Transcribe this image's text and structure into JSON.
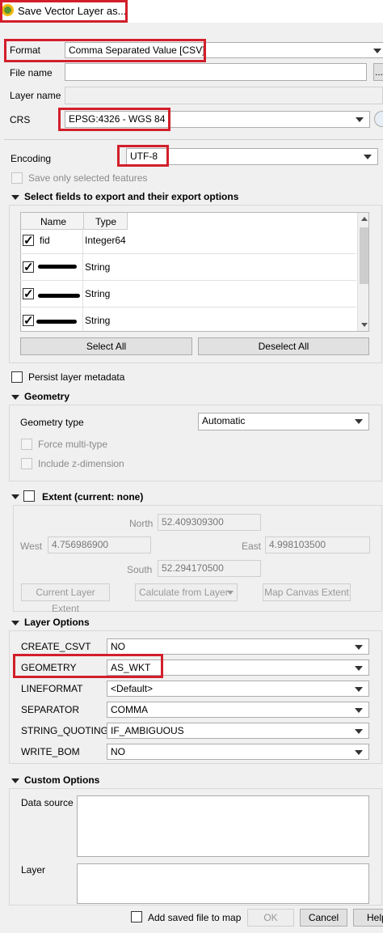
{
  "window": {
    "title": "Save Vector Layer as..."
  },
  "format": {
    "label": "Format",
    "value": "Comma Separated Value [CSV]"
  },
  "file_name": {
    "label": "File name",
    "value": "",
    "browse_label": "..."
  },
  "layer_name": {
    "label": "Layer name",
    "value": ""
  },
  "crs": {
    "label": "CRS",
    "value": "EPSG:4326 - WGS 84"
  },
  "encoding": {
    "label": "Encoding",
    "value": "UTF-8"
  },
  "save_only_selected": {
    "label": "Save only selected features",
    "checked": false,
    "enabled": false
  },
  "fields_section": {
    "title": "Select fields to export and their export options",
    "columns": [
      "Name",
      "Type"
    ],
    "rows": [
      {
        "name": "fid",
        "type": "Integer64",
        "checked": true
      },
      {
        "name": "",
        "type": "String",
        "checked": true
      },
      {
        "name": "",
        "type": "String",
        "checked": true
      },
      {
        "name": "",
        "type": "String",
        "checked": true
      }
    ],
    "select_all": "Select All",
    "deselect_all": "Deselect All"
  },
  "persist_metadata": {
    "label": "Persist layer metadata",
    "checked": false
  },
  "geometry": {
    "title": "Geometry",
    "type_label": "Geometry type",
    "type_value": "Automatic",
    "force_multi": "Force multi-type",
    "include_z": "Include z-dimension"
  },
  "extent": {
    "title": "Extent (current: none)",
    "north_label": "North",
    "north": "52.409309300",
    "west_label": "West",
    "west": "4.756986900",
    "east_label": "East",
    "east": "4.998103500",
    "south_label": "South",
    "south": "52.294170500",
    "current_layer": "Current Layer Extent",
    "calc_from_layer": "Calculate from Layer",
    "map_canvas": "Map Canvas Extent"
  },
  "layer_options": {
    "title": "Layer Options",
    "options": [
      {
        "name": "CREATE_CSVT",
        "value": "NO"
      },
      {
        "name": "GEOMETRY",
        "value": "AS_WKT"
      },
      {
        "name": "LINEFORMAT",
        "value": "<Default>"
      },
      {
        "name": "SEPARATOR",
        "value": "COMMA"
      },
      {
        "name": "STRING_QUOTING",
        "value": "IF_AMBIGUOUS"
      },
      {
        "name": "WRITE_BOM",
        "value": "NO"
      }
    ]
  },
  "custom_options": {
    "title": "Custom Options",
    "data_source_label": "Data source",
    "layer_label": "Layer"
  },
  "footer": {
    "add_to_map": "Add saved file to map",
    "ok": "OK",
    "cancel": "Cancel",
    "help": "Help"
  },
  "colors": {
    "highlight": "#d21f2b",
    "qgis_green": "#589632",
    "qgis_yellow": "#f0b90f"
  }
}
